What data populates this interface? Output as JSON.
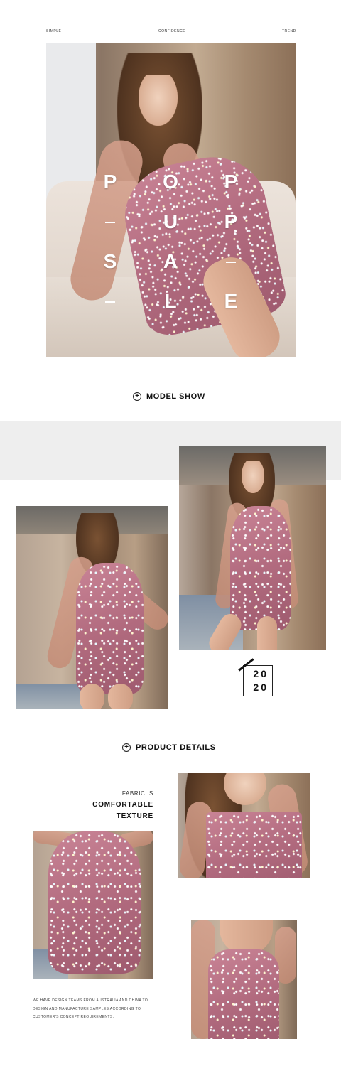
{
  "tagline": [
    "SIMPLE",
    "-",
    "CONFIDENCE",
    "-",
    "TREND"
  ],
  "hero": {
    "letters": [
      "P",
      "O",
      "P",
      "U",
      "P",
      "S",
      "A",
      "L",
      "E"
    ]
  },
  "sections": {
    "model_show": "MODEL SHOW",
    "product_details": "PRODUCT DETAILS"
  },
  "year": {
    "line1": "20",
    "line2": "20"
  },
  "fabric": {
    "label": "FABRIC IS",
    "line1": "COMFORTABLE",
    "line2": "TEXTURE"
  },
  "description": "WE HAVE DESIGN TEAMS FROM AUSTRALIA AND CHINA TO DESIGN AND MANUFACTURE SAMPLES ACCORDING TO CUSTOMER'S CONCEPT REQUIREMENTS.",
  "icons": [
    "plus-circle-icon"
  ],
  "colors": {
    "dress_pink": "#b26b7f",
    "band_grey": "#eeeeee"
  }
}
